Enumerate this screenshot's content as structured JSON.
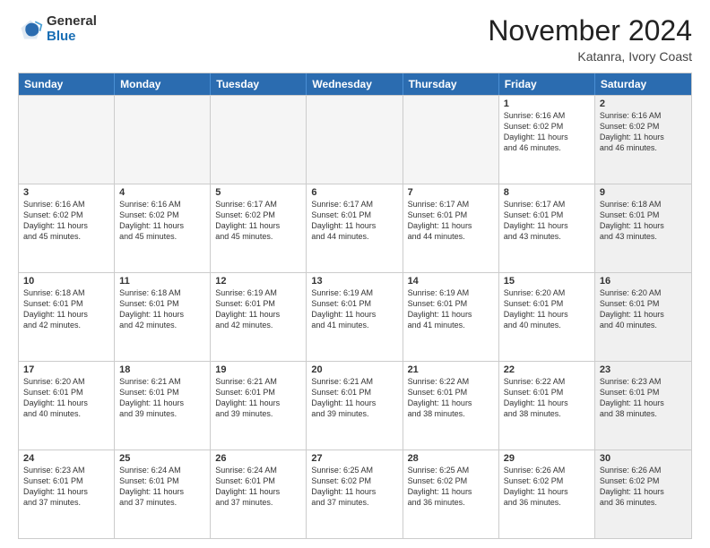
{
  "header": {
    "logo_line1": "General",
    "logo_line2": "Blue",
    "month_title": "November 2024",
    "location": "Katanra, Ivory Coast"
  },
  "weekdays": [
    "Sunday",
    "Monday",
    "Tuesday",
    "Wednesday",
    "Thursday",
    "Friday",
    "Saturday"
  ],
  "rows": [
    [
      {
        "day": "",
        "text": "",
        "empty": true
      },
      {
        "day": "",
        "text": "",
        "empty": true
      },
      {
        "day": "",
        "text": "",
        "empty": true
      },
      {
        "day": "",
        "text": "",
        "empty": true
      },
      {
        "day": "",
        "text": "",
        "empty": true
      },
      {
        "day": "1",
        "text": "Sunrise: 6:16 AM\nSunset: 6:02 PM\nDaylight: 11 hours\nand 46 minutes.",
        "shaded": false
      },
      {
        "day": "2",
        "text": "Sunrise: 6:16 AM\nSunset: 6:02 PM\nDaylight: 11 hours\nand 46 minutes.",
        "shaded": true
      }
    ],
    [
      {
        "day": "3",
        "text": "Sunrise: 6:16 AM\nSunset: 6:02 PM\nDaylight: 11 hours\nand 45 minutes.",
        "shaded": false
      },
      {
        "day": "4",
        "text": "Sunrise: 6:16 AM\nSunset: 6:02 PM\nDaylight: 11 hours\nand 45 minutes.",
        "shaded": false
      },
      {
        "day": "5",
        "text": "Sunrise: 6:17 AM\nSunset: 6:02 PM\nDaylight: 11 hours\nand 45 minutes.",
        "shaded": false
      },
      {
        "day": "6",
        "text": "Sunrise: 6:17 AM\nSunset: 6:01 PM\nDaylight: 11 hours\nand 44 minutes.",
        "shaded": false
      },
      {
        "day": "7",
        "text": "Sunrise: 6:17 AM\nSunset: 6:01 PM\nDaylight: 11 hours\nand 44 minutes.",
        "shaded": false
      },
      {
        "day": "8",
        "text": "Sunrise: 6:17 AM\nSunset: 6:01 PM\nDaylight: 11 hours\nand 43 minutes.",
        "shaded": false
      },
      {
        "day": "9",
        "text": "Sunrise: 6:18 AM\nSunset: 6:01 PM\nDaylight: 11 hours\nand 43 minutes.",
        "shaded": true
      }
    ],
    [
      {
        "day": "10",
        "text": "Sunrise: 6:18 AM\nSunset: 6:01 PM\nDaylight: 11 hours\nand 42 minutes.",
        "shaded": false
      },
      {
        "day": "11",
        "text": "Sunrise: 6:18 AM\nSunset: 6:01 PM\nDaylight: 11 hours\nand 42 minutes.",
        "shaded": false
      },
      {
        "day": "12",
        "text": "Sunrise: 6:19 AM\nSunset: 6:01 PM\nDaylight: 11 hours\nand 42 minutes.",
        "shaded": false
      },
      {
        "day": "13",
        "text": "Sunrise: 6:19 AM\nSunset: 6:01 PM\nDaylight: 11 hours\nand 41 minutes.",
        "shaded": false
      },
      {
        "day": "14",
        "text": "Sunrise: 6:19 AM\nSunset: 6:01 PM\nDaylight: 11 hours\nand 41 minutes.",
        "shaded": false
      },
      {
        "day": "15",
        "text": "Sunrise: 6:20 AM\nSunset: 6:01 PM\nDaylight: 11 hours\nand 40 minutes.",
        "shaded": false
      },
      {
        "day": "16",
        "text": "Sunrise: 6:20 AM\nSunset: 6:01 PM\nDaylight: 11 hours\nand 40 minutes.",
        "shaded": true
      }
    ],
    [
      {
        "day": "17",
        "text": "Sunrise: 6:20 AM\nSunset: 6:01 PM\nDaylight: 11 hours\nand 40 minutes.",
        "shaded": false
      },
      {
        "day": "18",
        "text": "Sunrise: 6:21 AM\nSunset: 6:01 PM\nDaylight: 11 hours\nand 39 minutes.",
        "shaded": false
      },
      {
        "day": "19",
        "text": "Sunrise: 6:21 AM\nSunset: 6:01 PM\nDaylight: 11 hours\nand 39 minutes.",
        "shaded": false
      },
      {
        "day": "20",
        "text": "Sunrise: 6:21 AM\nSunset: 6:01 PM\nDaylight: 11 hours\nand 39 minutes.",
        "shaded": false
      },
      {
        "day": "21",
        "text": "Sunrise: 6:22 AM\nSunset: 6:01 PM\nDaylight: 11 hours\nand 38 minutes.",
        "shaded": false
      },
      {
        "day": "22",
        "text": "Sunrise: 6:22 AM\nSunset: 6:01 PM\nDaylight: 11 hours\nand 38 minutes.",
        "shaded": false
      },
      {
        "day": "23",
        "text": "Sunrise: 6:23 AM\nSunset: 6:01 PM\nDaylight: 11 hours\nand 38 minutes.",
        "shaded": true
      }
    ],
    [
      {
        "day": "24",
        "text": "Sunrise: 6:23 AM\nSunset: 6:01 PM\nDaylight: 11 hours\nand 37 minutes.",
        "shaded": false
      },
      {
        "day": "25",
        "text": "Sunrise: 6:24 AM\nSunset: 6:01 PM\nDaylight: 11 hours\nand 37 minutes.",
        "shaded": false
      },
      {
        "day": "26",
        "text": "Sunrise: 6:24 AM\nSunset: 6:01 PM\nDaylight: 11 hours\nand 37 minutes.",
        "shaded": false
      },
      {
        "day": "27",
        "text": "Sunrise: 6:25 AM\nSunset: 6:02 PM\nDaylight: 11 hours\nand 37 minutes.",
        "shaded": false
      },
      {
        "day": "28",
        "text": "Sunrise: 6:25 AM\nSunset: 6:02 PM\nDaylight: 11 hours\nand 36 minutes.",
        "shaded": false
      },
      {
        "day": "29",
        "text": "Sunrise: 6:26 AM\nSunset: 6:02 PM\nDaylight: 11 hours\nand 36 minutes.",
        "shaded": false
      },
      {
        "day": "30",
        "text": "Sunrise: 6:26 AM\nSunset: 6:02 PM\nDaylight: 11 hours\nand 36 minutes.",
        "shaded": true
      }
    ]
  ]
}
